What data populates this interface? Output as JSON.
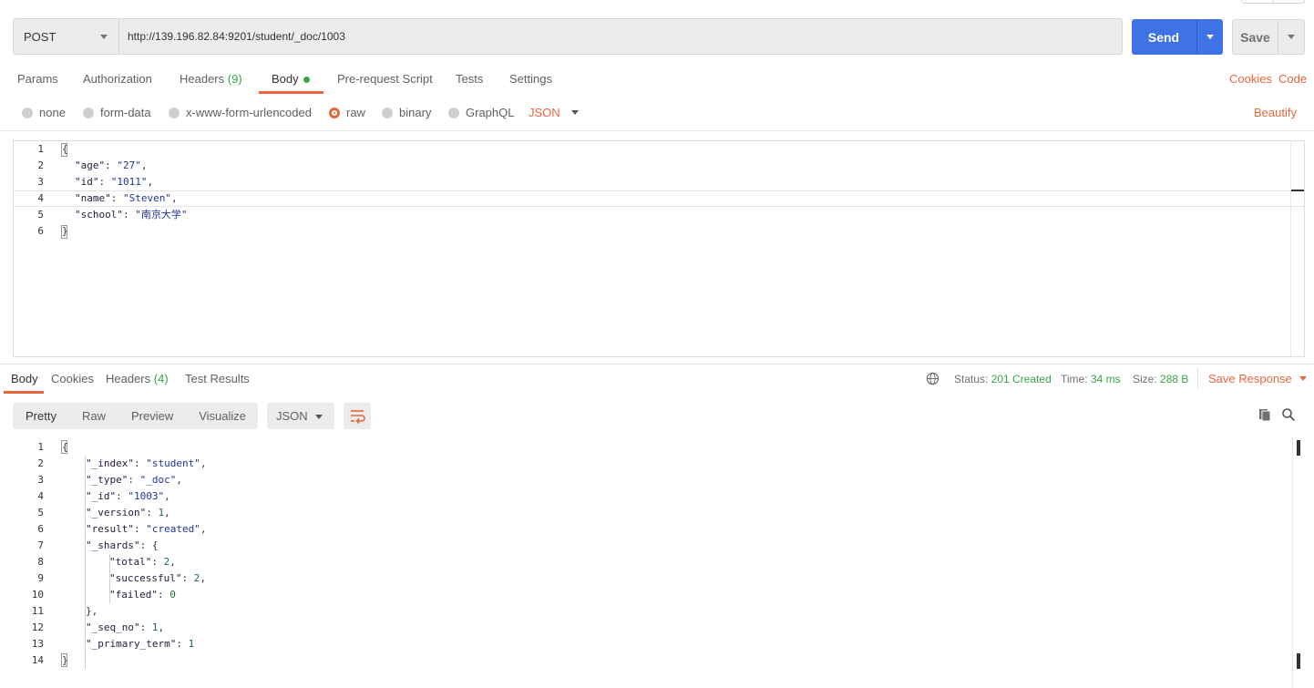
{
  "request": {
    "method": "POST",
    "url": "http://139.196.82.84:9201/student/_doc/1003",
    "send_label": "Send",
    "save_label": "Save"
  },
  "request_tabs": {
    "params": "Params",
    "authorization": "Authorization",
    "headers": "Headers",
    "headers_count": "(9)",
    "body": "Body",
    "prerequest": "Pre-request Script",
    "tests": "Tests",
    "settings": "Settings",
    "cookies": "Cookies",
    "code": "Code"
  },
  "body_types": {
    "none": "none",
    "form_data": "form-data",
    "urlencoded": "x-www-form-urlencoded",
    "raw": "raw",
    "binary": "binary",
    "graphql": "GraphQL",
    "format": "JSON",
    "beautify": "Beautify",
    "selected": "raw"
  },
  "request_body": {
    "line_numbers": [
      "1",
      "2",
      "3",
      "4",
      "5",
      "6"
    ],
    "lines": {
      "l1": "{",
      "l2_key": "\"age\"",
      "l2_val": "\"27\"",
      "l3_key": "\"id\"",
      "l3_val": "\"1011\"",
      "l4_key": "\"name\"",
      "l4_val": "\"Steven\"",
      "l5_key": "\"school\"",
      "l5_val": "\"南京大学\"",
      "l6": "}"
    }
  },
  "response_tabs": {
    "body": "Body",
    "cookies": "Cookies",
    "headers": "Headers",
    "headers_count": "(4)",
    "test_results": "Test Results"
  },
  "response_meta": {
    "status_label": "Status:",
    "status_value": "201 Created",
    "time_label": "Time:",
    "time_value": "34 ms",
    "size_label": "Size:",
    "size_value": "288 B",
    "save_response": "Save Response"
  },
  "response_view": {
    "pretty": "Pretty",
    "raw": "Raw",
    "preview": "Preview",
    "visualize": "Visualize",
    "format": "JSON"
  },
  "response_body": {
    "line_numbers": [
      "1",
      "2",
      "3",
      "4",
      "5",
      "6",
      "7",
      "8",
      "9",
      "10",
      "11",
      "12",
      "13",
      "14"
    ],
    "lines": {
      "l1": "{",
      "l2_key": "\"_index\"",
      "l2_val": "\"student\"",
      "l3_key": "\"_type\"",
      "l3_val": "\"_doc\"",
      "l4_key": "\"_id\"",
      "l4_val": "\"1003\"",
      "l5_key": "\"_version\"",
      "l5_val": "1",
      "l6_key": "\"result\"",
      "l6_val": "\"created\"",
      "l7_key": "\"_shards\"",
      "l7_val": "{",
      "l8_key": "\"total\"",
      "l8_val": "2",
      "l9_key": "\"successful\"",
      "l9_val": "2",
      "l10_key": "\"failed\"",
      "l10_val": "0",
      "l11": "},",
      "l12_key": "\"_seq_no\"",
      "l12_val": "1",
      "l13_key": "\"_primary_term\"",
      "l13_val": "1",
      "l14": "}"
    }
  },
  "colors": {
    "accent": "#e7663b",
    "send_button": "#3f73e5",
    "success": "#36a545"
  },
  "icons": [
    "chevron-down-icon",
    "globe-icon",
    "wrap-lines-icon",
    "copy-icon",
    "search-icon"
  ]
}
